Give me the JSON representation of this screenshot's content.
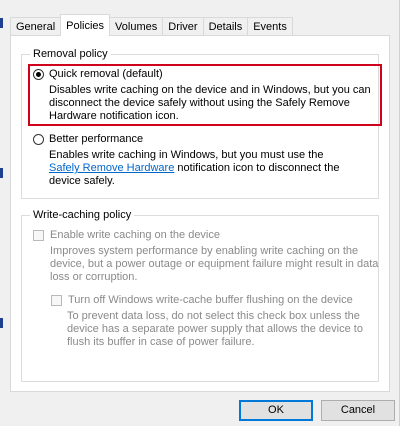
{
  "tabs": [
    "General",
    "Policies",
    "Volumes",
    "Driver",
    "Details",
    "Events"
  ],
  "active_tab": "Policies",
  "removal_policy": {
    "title": "Removal policy",
    "quick": {
      "label": "Quick removal (default)",
      "desc_line1": "Disables write caching on the device and in Windows, but you can",
      "desc_line2": "disconnect the device safely without using the Safely Remove",
      "desc_line3": "Hardware notification icon.",
      "selected": true
    },
    "better": {
      "label": "Better performance",
      "desc_line1": "Enables write caching in Windows, but you must use the",
      "desc_link": "Safely Remove Hardware",
      "desc_after_link": " notification icon to disconnect the",
      "desc_line3": "device safely.",
      "selected": false
    }
  },
  "write_caching": {
    "title": "Write-caching policy",
    "enable": {
      "label": "Enable write caching on the device",
      "desc_line1": "Improves system performance by enabling write caching on the",
      "desc_line2": "device, but a power outage or equipment failure might result in data",
      "desc_line3": "loss or corruption."
    },
    "turn_off": {
      "label": "Turn off Windows write-cache buffer flushing on the device",
      "desc_line1": "To prevent data loss, do not select this check box unless the",
      "desc_line2": "device has a separate power supply that allows the device to",
      "desc_line3": "flush its buffer in case of power failure."
    }
  },
  "buttons": {
    "ok": "OK",
    "cancel": "Cancel"
  },
  "colors": {
    "highlight": "#d0021b",
    "link": "#0066cc",
    "focus": "#0078d7"
  }
}
